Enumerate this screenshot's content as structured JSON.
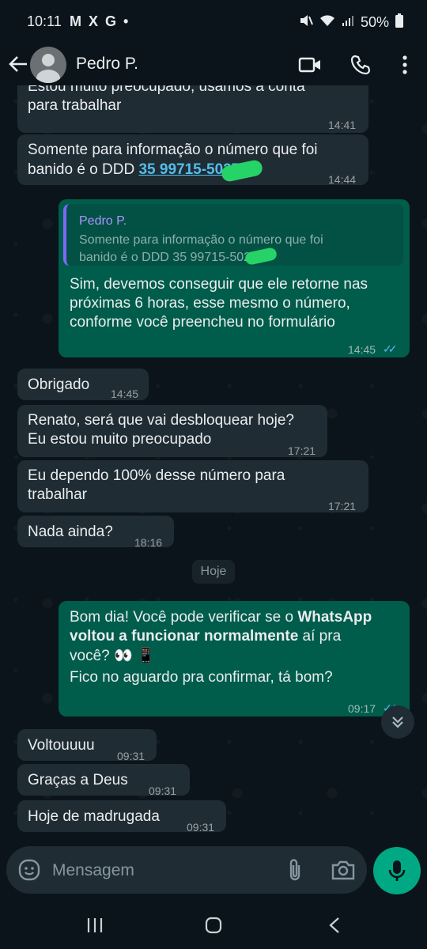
{
  "status_bar": {
    "time": "10:11",
    "notif_icons": "M X G •",
    "battery": "50%",
    "icons": [
      "mute-icon",
      "wifi-icon",
      "signal-icon",
      "battery-icon"
    ]
  },
  "header": {
    "contact_name": "Pedro P.",
    "icons": [
      "back-arrow-icon",
      "avatar",
      "video-call-icon",
      "phone-icon",
      "more-vert-icon"
    ]
  },
  "messages": [
    {
      "id": "m1",
      "dir": "in",
      "text": "Estou muito preocupado, usamos a conta",
      "text2": "para trabalhar",
      "time": "14:41"
    },
    {
      "id": "m2",
      "dir": "in",
      "text": "Somente para informação o número que foi",
      "text2_prefix": "banido é o DDD ",
      "link": "35 99715-5027",
      "time": "14:44"
    },
    {
      "id": "m3",
      "dir": "out",
      "quote_name": "Pedro P.",
      "quote_line1": "Somente para informação o número que foi",
      "quote_line2": "banido é o DDD 35 99715-5027",
      "text": "Sim, devemos conseguir que ele retorne nas",
      "text2": "próximas 6 horas, esse mesmo o número,",
      "text3": "conforme você preencheu no formulário",
      "time": "14:45"
    },
    {
      "id": "m4",
      "dir": "in",
      "text": "Obrigado",
      "time": "14:45"
    },
    {
      "id": "m5",
      "dir": "in",
      "text": "Renato, será que vai desbloquear hoje?",
      "text2": "Eu estou muito preocupado",
      "time": "17:21"
    },
    {
      "id": "m6",
      "dir": "in",
      "text": "Eu dependo 100% desse número para",
      "text2": "trabalhar",
      "time": "17:21"
    },
    {
      "id": "m7",
      "dir": "in",
      "text": "Nada ainda?",
      "time": "18:16"
    },
    {
      "id": "m8",
      "dir": "out",
      "text_a": "Bom dia! Você pode verificar se o ",
      "bold_a": "WhatsApp",
      "bold_b": "voltou a funcionar normalmente",
      "text_b": " aí pra",
      "text_c": "você? 👀 📱",
      "text_d": "Fico no aguardo pra confirmar, tá bom?",
      "time": "09:17"
    },
    {
      "id": "m9",
      "dir": "in",
      "text": "Voltouuuu",
      "time": "09:31"
    },
    {
      "id": "m10",
      "dir": "in",
      "text": "Graças a Deus",
      "time": "09:31"
    },
    {
      "id": "m11",
      "dir": "in",
      "text": "Hoje de madrugada",
      "time": "09:31"
    }
  ],
  "day_chip": "Hoje",
  "input": {
    "placeholder": "Mensagem",
    "icons": [
      "emoji-icon",
      "attach-icon",
      "camera-icon",
      "mic-icon"
    ]
  },
  "colors": {
    "background": "#0b141a",
    "incoming_bubble": "#202c33",
    "outgoing_bubble": "#005c4b",
    "accent": "#00a884",
    "link": "#53bdeb",
    "read_ticks": "#53bdeb"
  }
}
